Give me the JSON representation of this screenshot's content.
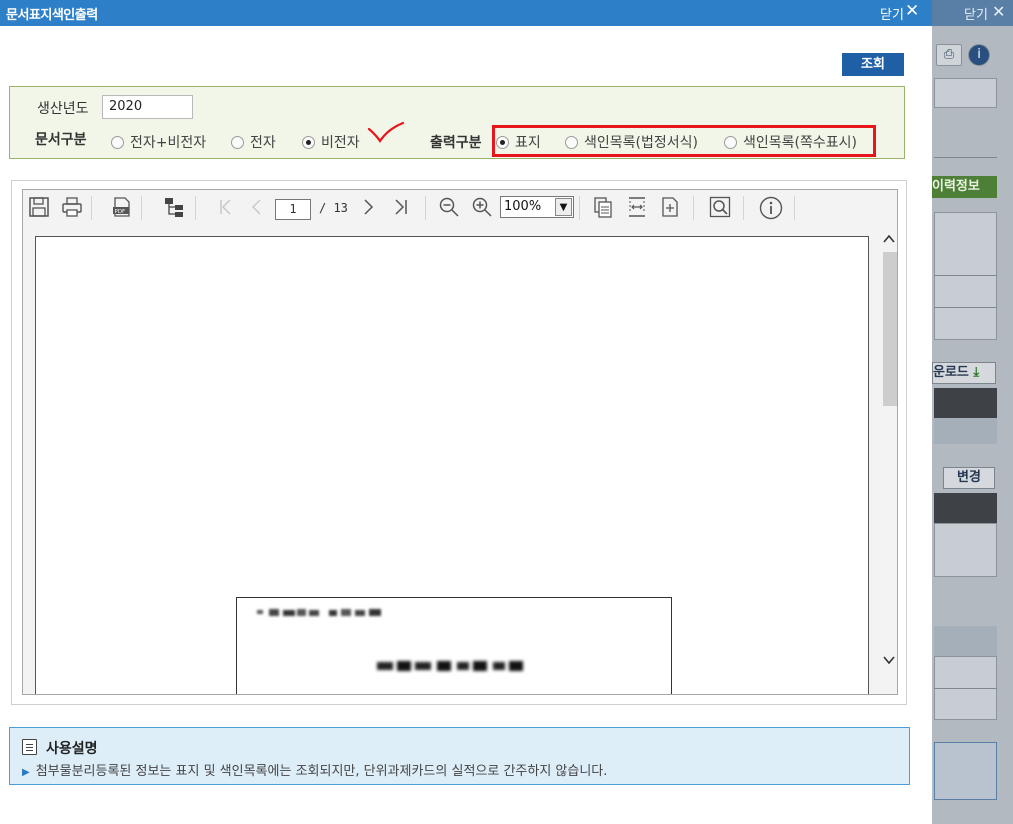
{
  "background_window": {
    "close_label": "닫기",
    "green_tab": "이력정보",
    "download_button": "운로드",
    "change_button": "변경"
  },
  "titlebar": {
    "title": "문서표지색인출력",
    "close_label": "닫기"
  },
  "search_button": "조회",
  "filter": {
    "year_label": "생산년도",
    "year_value": "2020",
    "doc_type_label": "문서구분",
    "doc_type_options": [
      "전자+비전자",
      "전자",
      "비전자"
    ],
    "doc_type_selected": "비전자",
    "output_type_label": "출력구분",
    "output_type_options": [
      "표지",
      "색인목록(법정서식)",
      "색인목록(쪽수표시)"
    ],
    "output_type_selected": "표지"
  },
  "viewer": {
    "current_page": "1",
    "page_total": "/ 13",
    "zoom": "100%"
  },
  "info": {
    "title": "사용설명",
    "text": "첨부물분리등록된 정보는 표지 및 색인목록에는 조회되지만, 단위과제카드의 실적으로 간주하지 않습니다."
  },
  "colors": {
    "titlebar": "#2d7fc8",
    "search_button": "#1f5fa6",
    "filter_bg": "#f1f6e8",
    "highlight_box": "#e8151d",
    "info_bg": "#deeef8"
  }
}
